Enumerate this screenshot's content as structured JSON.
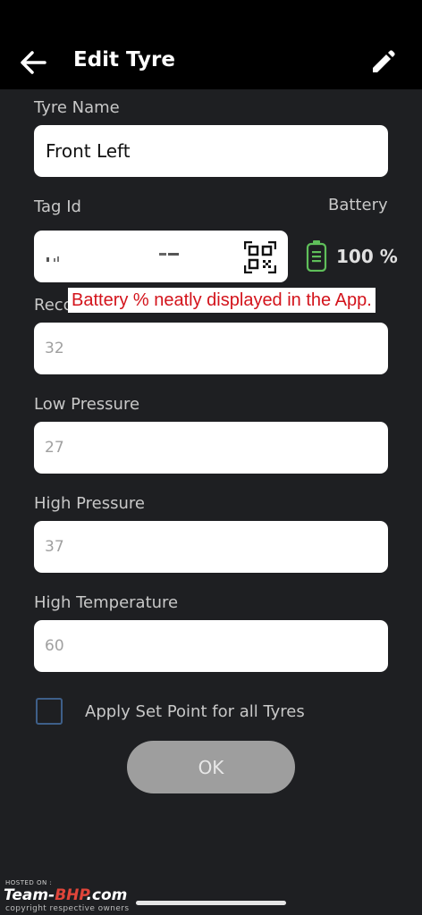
{
  "header": {
    "title": "Edit Tyre"
  },
  "form": {
    "tyre_name_label": "Tyre Name",
    "tyre_name_value": "Front Left",
    "tag_id_label": "Tag Id",
    "battery_label": "Battery",
    "battery_value": "100 %",
    "recommended_label_partial": "Reco",
    "recommended_value": "32",
    "low_pressure_label": "Low Pressure",
    "low_pressure_value": "27",
    "high_pressure_label": "High Pressure",
    "high_pressure_value": "37",
    "high_temperature_label": "High Temperature",
    "high_temperature_value": "60",
    "apply_all_label": "Apply Set Point for all Tyres",
    "apply_all_checked": false,
    "ok_label": "OK"
  },
  "annotation": {
    "text": "Battery % neatly displayed in the App."
  },
  "watermark": {
    "hosted": "HOSTED ON :",
    "brand_part1": "Team-",
    "brand_part2": "BHP",
    "brand_part3": ".com",
    "copyright": "copyright respective owners"
  },
  "colors": {
    "background": "#1e1f22",
    "appbar": "#000000",
    "battery_icon": "#5fbf5a",
    "annotation_text": "#d3131b",
    "checkbox_border": "#3e5f89",
    "ok_button": "#9e9e9e"
  },
  "icons": [
    "back-arrow-icon",
    "pencil-icon",
    "qr-code-icon",
    "battery-icon"
  ]
}
